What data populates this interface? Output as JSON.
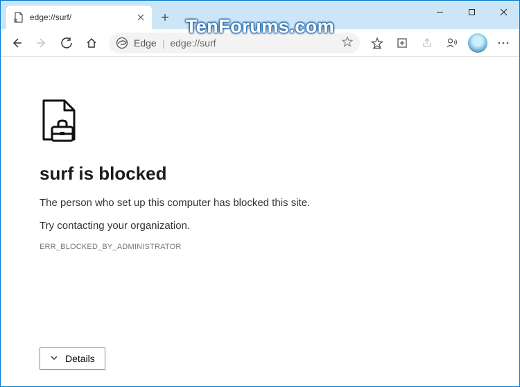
{
  "tab": {
    "title": "edge://surf/"
  },
  "toolbar": {
    "addr_prefix": "Edge",
    "addr_url": "edge://surf"
  },
  "page": {
    "heading": "surf is blocked",
    "message1": "The person who set up this computer has blocked this site.",
    "message2": "Try contacting your organization.",
    "error_code": "ERR_BLOCKED_BY_ADMINISTRATOR",
    "details_label": "Details"
  },
  "watermark": "TenForums.com"
}
